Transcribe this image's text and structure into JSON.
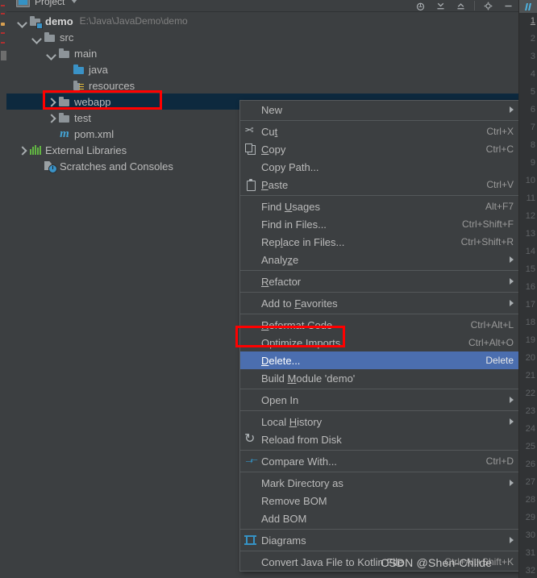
{
  "window": {
    "panel_title": "Project",
    "panel_icon": "project-icon",
    "caret_icon": "chevron-down-icon",
    "toolbar_icons": [
      {
        "name": "locate-icon",
        "glyph": "⊕"
      },
      {
        "name": "collapse-all-icon",
        "glyph": "⤓"
      },
      {
        "name": "expand-all-icon",
        "glyph": "⤒"
      },
      {
        "name": "settings-gear-icon",
        "glyph": "⚙"
      },
      {
        "name": "hide-panel-icon",
        "glyph": "—"
      }
    ]
  },
  "tree": {
    "items": [
      {
        "label": "demo",
        "path": "E:\\Java\\JavaDemo\\demo",
        "indent": 14,
        "arrow": "down",
        "icon": "module-folder-icon",
        "bold": true,
        "selected": false
      },
      {
        "label": "src",
        "path": "",
        "indent": 32,
        "arrow": "down",
        "icon": "folder-grey-icon",
        "bold": false,
        "selected": false
      },
      {
        "label": "main",
        "path": "",
        "indent": 50,
        "arrow": "down",
        "icon": "folder-grey-icon",
        "bold": false,
        "selected": false
      },
      {
        "label": "java",
        "path": "",
        "indent": 68,
        "arrow": "none",
        "icon": "folder-blue-icon",
        "bold": false,
        "selected": false
      },
      {
        "label": "resources",
        "path": "",
        "indent": 68,
        "arrow": "none",
        "icon": "folder-resources-icon",
        "bold": false,
        "selected": false
      },
      {
        "label": "webapp",
        "path": "",
        "indent": 50,
        "arrow": "right",
        "icon": "folder-grey-icon",
        "bold": false,
        "selected": true
      },
      {
        "label": "test",
        "path": "",
        "indent": 50,
        "arrow": "right",
        "icon": "folder-grey-icon",
        "bold": false,
        "selected": false
      },
      {
        "label": "pom.xml",
        "path": "",
        "indent": 50,
        "arrow": "none",
        "icon": "maven-m-icon",
        "bold": false,
        "selected": false
      },
      {
        "label": "External Libraries",
        "path": "",
        "indent": 14,
        "arrow": "right",
        "icon": "libraries-icon",
        "bold": false,
        "selected": false
      },
      {
        "label": "Scratches and Consoles",
        "path": "",
        "indent": 32,
        "arrow": "none",
        "icon": "scratches-icon",
        "bold": false,
        "selected": false
      }
    ]
  },
  "context_menu": {
    "items": [
      {
        "label": "New",
        "accel": "",
        "icon": "",
        "submenu": true,
        "highlighted": false,
        "mnemonic": -1
      },
      {
        "sep": true
      },
      {
        "label": "Cut",
        "accel": "Ctrl+X",
        "icon": "cut-icon",
        "submenu": false,
        "highlighted": false,
        "mnemonic": 2
      },
      {
        "label": "Copy",
        "accel": "Ctrl+C",
        "icon": "copy-icon",
        "submenu": false,
        "highlighted": false,
        "mnemonic": 0
      },
      {
        "label": "Copy Path...",
        "accel": "",
        "icon": "",
        "submenu": false,
        "highlighted": false,
        "mnemonic": -1
      },
      {
        "label": "Paste",
        "accel": "Ctrl+V",
        "icon": "paste-icon",
        "submenu": false,
        "highlighted": false,
        "mnemonic": 0
      },
      {
        "sep": true
      },
      {
        "label": "Find Usages",
        "accel": "Alt+F7",
        "icon": "",
        "submenu": false,
        "highlighted": false,
        "mnemonic": 5
      },
      {
        "label": "Find in Files...",
        "accel": "Ctrl+Shift+F",
        "icon": "",
        "submenu": false,
        "highlighted": false,
        "mnemonic": -1
      },
      {
        "label": "Replace in Files...",
        "accel": "Ctrl+Shift+R",
        "icon": "",
        "submenu": false,
        "highlighted": false,
        "mnemonic": 3
      },
      {
        "label": "Analyze",
        "accel": "",
        "icon": "",
        "submenu": true,
        "highlighted": false,
        "mnemonic": 5
      },
      {
        "sep": true
      },
      {
        "label": "Refactor",
        "accel": "",
        "icon": "",
        "submenu": true,
        "highlighted": false,
        "mnemonic": 0
      },
      {
        "sep": true
      },
      {
        "label": "Add to Favorites",
        "accel": "",
        "icon": "",
        "submenu": true,
        "highlighted": false,
        "mnemonic": 7
      },
      {
        "sep": true
      },
      {
        "label": "Reformat Code",
        "accel": "Ctrl+Alt+L",
        "icon": "",
        "submenu": false,
        "highlighted": false,
        "mnemonic": 0
      },
      {
        "label": "Optimize Imports",
        "accel": "Ctrl+Alt+O",
        "icon": "",
        "submenu": false,
        "highlighted": false,
        "mnemonic": -1
      },
      {
        "label": "Delete...",
        "accel": "Delete",
        "icon": "",
        "submenu": false,
        "highlighted": true,
        "mnemonic": 0
      },
      {
        "label": "Build Module 'demo'",
        "accel": "",
        "icon": "",
        "submenu": false,
        "highlighted": false,
        "mnemonic": 6
      },
      {
        "sep": true
      },
      {
        "label": "Open In",
        "accel": "",
        "icon": "",
        "submenu": true,
        "highlighted": false,
        "mnemonic": -1
      },
      {
        "sep": true
      },
      {
        "label": "Local History",
        "accel": "",
        "icon": "",
        "submenu": true,
        "highlighted": false,
        "mnemonic": 6
      },
      {
        "label": "Reload from Disk",
        "accel": "",
        "icon": "reload-icon",
        "submenu": false,
        "highlighted": false,
        "mnemonic": -1
      },
      {
        "sep": true
      },
      {
        "label": "Compare With...",
        "accel": "Ctrl+D",
        "icon": "compare-icon",
        "submenu": false,
        "highlighted": false,
        "mnemonic": -1
      },
      {
        "sep": true
      },
      {
        "label": "Mark Directory as",
        "accel": "",
        "icon": "",
        "submenu": true,
        "highlighted": false,
        "mnemonic": -1
      },
      {
        "label": "Remove BOM",
        "accel": "",
        "icon": "",
        "submenu": false,
        "highlighted": false,
        "mnemonic": -1
      },
      {
        "label": "Add BOM",
        "accel": "",
        "icon": "",
        "submenu": false,
        "highlighted": false,
        "mnemonic": -1
      },
      {
        "sep": true
      },
      {
        "label": "Diagrams",
        "accel": "",
        "icon": "diagram-icon",
        "submenu": true,
        "highlighted": false,
        "mnemonic": -1
      },
      {
        "sep": true
      },
      {
        "label": "Convert Java File to Kotlin File",
        "accel": "Ctrl+Alt+Shift+K",
        "icon": "",
        "submenu": false,
        "highlighted": false,
        "mnemonic": -1
      }
    ]
  },
  "gutter": {
    "line_numbers": [
      "1",
      "2",
      "3",
      "4",
      "5",
      "6",
      "7",
      "8",
      "9",
      "10",
      "11",
      "12",
      "13",
      "14",
      "15",
      "16",
      "17",
      "18",
      "19",
      "20",
      "21",
      "22",
      "23",
      "24",
      "25",
      "26",
      "27",
      "28",
      "29",
      "30",
      "31",
      "32"
    ]
  },
  "watermark": {
    "text": "CSDN @Shen-Childe"
  },
  "colors": {
    "panel_bg": "#3c3f41",
    "selection_bg": "#0d293e",
    "menu_highlight": "#4b6eaf",
    "annotation_red": "#ff0000",
    "accent_blue": "#3592c4",
    "gutter_bg": "#313335"
  }
}
